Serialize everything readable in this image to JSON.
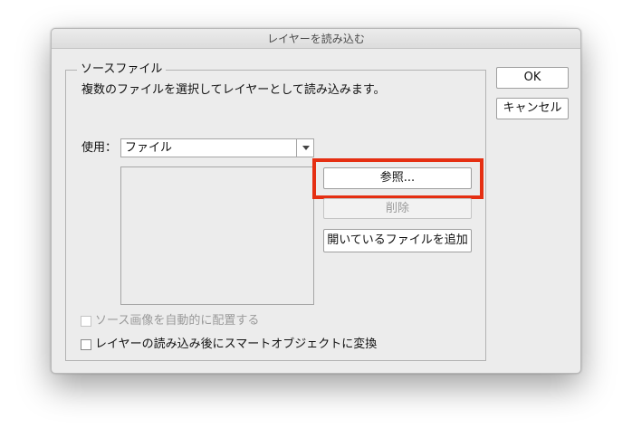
{
  "dialog": {
    "title": "レイヤーを読み込む",
    "group": {
      "legend": "ソースファイル",
      "description": "複数のファイルを選択してレイヤーとして読み込みます。",
      "use_label": "使用：",
      "use_select": {
        "value": "ファイル"
      }
    },
    "buttons": {
      "browse": "参照...",
      "delete": "削除",
      "add_open_files": "開いているファイルを追加",
      "ok": "OK",
      "cancel": "キャンセル"
    },
    "checkboxes": [
      {
        "label": "ソース画像を自動的に配置する",
        "checked": false,
        "enabled": false
      },
      {
        "label": "レイヤーの読み込み後にスマートオブジェクトに変換",
        "checked": false,
        "enabled": true
      }
    ],
    "colors": {
      "highlight": "#e52f12",
      "dialog_bg": "#ececec",
      "disabled_text": "#9a9a9a"
    }
  }
}
